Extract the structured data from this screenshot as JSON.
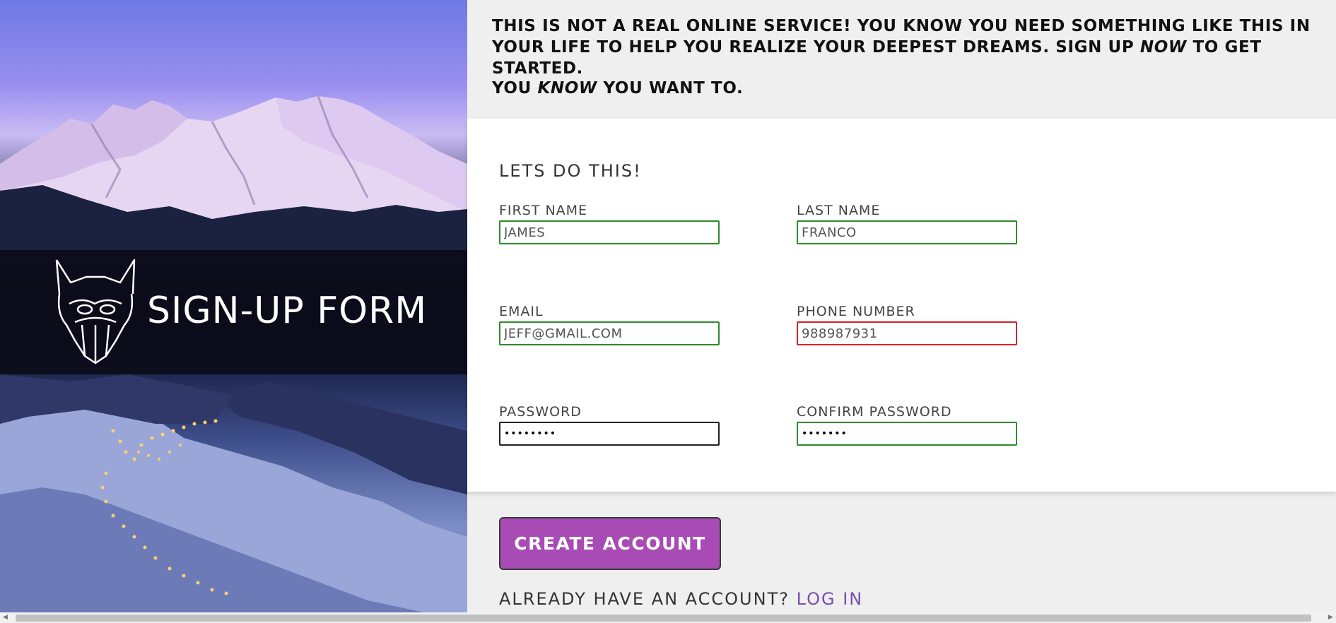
{
  "hero": {
    "brand_title": "SIGN-UP FORM"
  },
  "intro": {
    "line1_start": "THIS IS NOT A REAL ONLINE SERVICE! YOU KNOW YOU NEED SOMETHING LIKE THIS IN YOUR LIFE TO HELP YOU REALIZE YOUR DEEPEST DREAMS. SIGN UP ",
    "line1_emphasis": "NOW",
    "line1_end": " TO GET STARTED.",
    "line2_start": "YOU ",
    "line2_emphasis": "KNOW",
    "line2_end": " YOU WANT TO."
  },
  "form": {
    "heading": "LETS DO THIS!",
    "first_name": {
      "label": "FIRST NAME",
      "value": "JAMES",
      "state": "valid"
    },
    "last_name": {
      "label": "LAST NAME",
      "value": "FRANCO",
      "state": "valid"
    },
    "email": {
      "label": "EMAIL",
      "value": "JEFF@GMAIL.COM",
      "state": "valid"
    },
    "phone": {
      "label": "PHONE NUMBER",
      "value": "988987931",
      "state": "invalid"
    },
    "password": {
      "label": "PASSWORD",
      "value": "••••••••",
      "state": "focused"
    },
    "confirm_password": {
      "label": "CONFIRM PASSWORD",
      "value": "•••••••",
      "state": "valid"
    }
  },
  "actions": {
    "create_account": "CREATE ACCOUNT",
    "login_prompt": "ALREADY HAVE AN ACCOUNT? ",
    "login_link": "LOG IN"
  },
  "colors": {
    "valid_border": "#2e8b2e",
    "invalid_border": "#d0242a",
    "button_bg": "#a84bb5",
    "link": "#7a4fb0"
  }
}
